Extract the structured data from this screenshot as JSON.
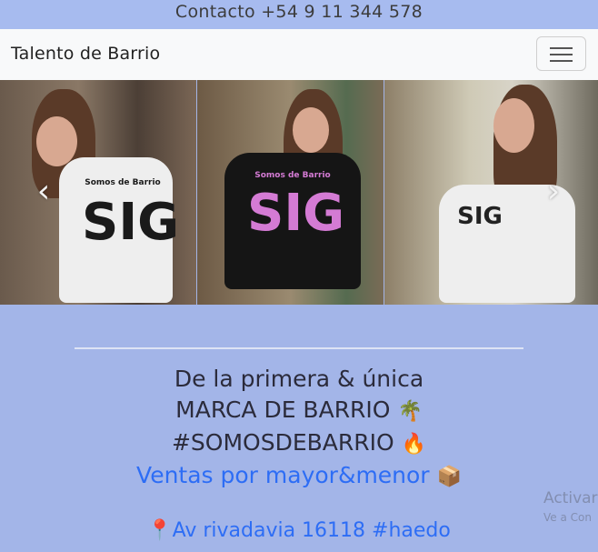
{
  "topbar": {
    "contact": "Contacto +54 9 11 344 578"
  },
  "navbar": {
    "brand": "Talento de Barrio",
    "menu_icon": "hamburger-icon"
  },
  "carousel": {
    "prev_icon": "chevron-left-icon",
    "next_icon": "chevron-right-icon",
    "prev_glyph": "‹",
    "next_glyph": "›",
    "slides": [
      {
        "print_top": "Somos de Barrio",
        "print_main": "SIG"
      },
      {
        "print_top": "Somos de Barrio",
        "print_main": "SIG"
      },
      {
        "print_main": "SIG"
      }
    ]
  },
  "tagline": {
    "line1": "De la primera & única",
    "line2": "MARCA DE BARRIO",
    "line2_emoji": "🌴",
    "line3": "#SOMOSDEBARRIO",
    "line3_emoji": "🔥",
    "line4": "Ventas por mayor&menor",
    "line4_emoji": "📦"
  },
  "address": {
    "pin": "📍",
    "text": "Av rivadavia 16118 #haedo"
  },
  "watermark": {
    "line1": "Activar",
    "line2": "Ve a Con"
  },
  "colors": {
    "background": "#a3b5e8",
    "link": "#2d6df5",
    "navbar": "#f8f9fa"
  }
}
